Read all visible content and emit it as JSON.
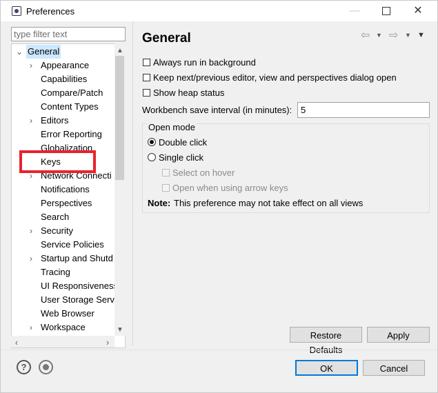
{
  "window": {
    "title": "Preferences"
  },
  "filter": {
    "placeholder": "type filter text"
  },
  "tree": {
    "root": "General",
    "items": [
      "Appearance",
      "Capabilities",
      "Compare/Patch",
      "Content Types",
      "Editors",
      "Error Reporting",
      "Globalization",
      "Keys",
      "Network Connecti",
      "Notifications",
      "Perspectives",
      "Search",
      "Security",
      "Service Policies",
      "Startup and Shutd",
      "Tracing",
      "UI Responsiveness",
      "User Storage Serv",
      "Web Browser",
      "Workspace"
    ]
  },
  "page": {
    "title": "General",
    "always_run_bg": "Always run in background",
    "keep_next_prev": "Keep next/previous editor, view and perspectives dialog open",
    "show_heap": "Show heap status",
    "interval_label": "Workbench save interval (in minutes):",
    "interval_value": "5",
    "open_mode": {
      "label": "Open mode",
      "double_click": "Double click",
      "single_click": "Single click",
      "select_on_hover": "Select on hover",
      "open_arrow_keys": "Open when using arrow keys"
    },
    "note_label": "Note:",
    "note_text": "This preference may not take effect on all views"
  },
  "buttons": {
    "restore_defaults": "Restore Defaults",
    "apply": "Apply",
    "ok": "OK",
    "cancel": "Cancel"
  },
  "icons": {
    "help": "?",
    "back": "⇦",
    "forward": "⇨",
    "dropdown": "▼"
  },
  "colors": {
    "selection": "#cce8ff",
    "default_button_border": "#0078d7",
    "highlight_box": "#e8232d"
  }
}
